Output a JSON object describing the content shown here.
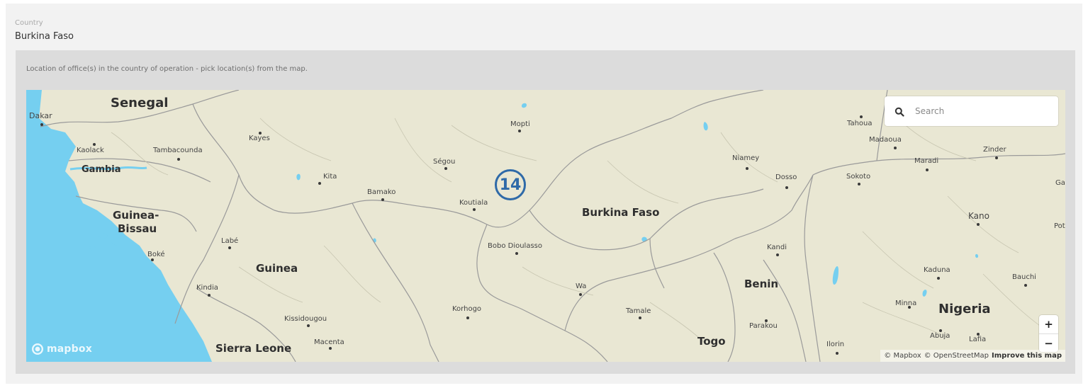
{
  "form": {
    "country_label": "Country",
    "country_value": "Burkina Faso",
    "map_caption": "Location of office(s) in the country of operation - pick location(s) from the map."
  },
  "map": {
    "search_placeholder": "Search",
    "cluster_count": "14",
    "zoom_in_label": "+",
    "zoom_out_label": "−",
    "logo_text": "mapbox",
    "attribution": {
      "mapbox": "© Mapbox",
      "osm": "© OpenStreetMap",
      "improve": "Improve this map"
    },
    "colors": {
      "land": "#e9e7d3",
      "water": "#75cff0",
      "cluster": "#2f6aa8"
    },
    "countries": {
      "senegal": "Senegal",
      "gambia": "Gambia",
      "guinea_bissau_1": "Guinea-",
      "guinea_bissau_2": "Bissau",
      "guinea": "Guinea",
      "sierra_leone": "Sierra Leone",
      "burkina_faso": "Burkina Faso",
      "benin": "Benin",
      "togo": "Togo",
      "nigeria": "Nigeria"
    },
    "cities": {
      "dakar": "Dakar",
      "kaolack": "Kaolack",
      "tambacounda": "Tambacounda",
      "kayes": "Kayes",
      "kita": "Kita",
      "bamako": "Bamako",
      "segou": "Ségou",
      "mopti": "Mopti",
      "koutiala": "Koutiala",
      "bobo": "Bobo Dioulasso",
      "labe": "Labé",
      "boke": "Boké",
      "kindia": "Kindia",
      "kissidougou": "Kissidougou",
      "macenta": "Macenta",
      "korhogo": "Korhogo",
      "wa": "Wa",
      "tamale": "Tamale",
      "niamey": "Niamey",
      "dosso": "Dosso",
      "kandi": "Kandi",
      "parakou": "Parakou",
      "ilorin": "Ilorin",
      "tahoua": "Tahoua",
      "madaoua": "Madaoua",
      "maradi": "Maradi",
      "zinder": "Zinder",
      "sokoto": "Sokoto",
      "kano": "Kano",
      "kaduna": "Kaduna",
      "bauchi": "Bauchi",
      "minna": "Minna",
      "abuja": "Abuja",
      "lafia": "Lafia",
      "ga": "Ga",
      "pot": "Pot"
    }
  }
}
